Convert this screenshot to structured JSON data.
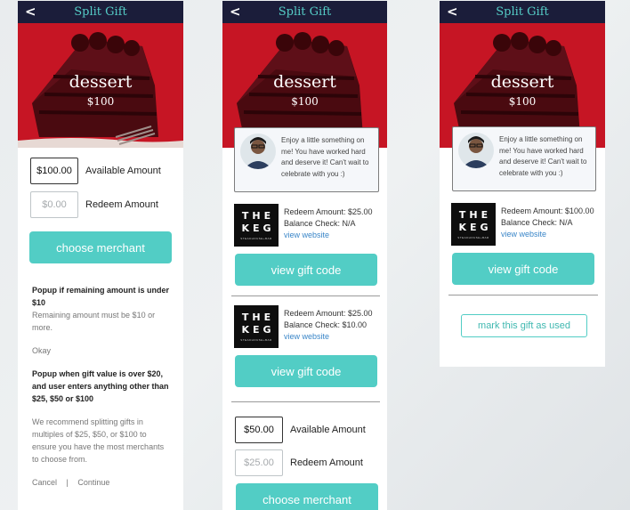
{
  "screens": [
    {
      "back": "<",
      "title": "Split Gift",
      "hero": {
        "name": "dessert",
        "value": "$100"
      },
      "available_amount": "$100.00",
      "available_label": "Available Amount",
      "redeem_amount": "$0.00",
      "redeem_label": "Redeem Amount",
      "choose_button": "choose merchant",
      "notes": {
        "popup1_title": "Popup if remaining amount is under $10",
        "popup1_body": "Remaining amount must be $10 or more.",
        "okay": "Okay",
        "popup2_title": "Popup when gift value is over $20, and user enters anything other than $25, $50 or $100",
        "popup2_body": "We recommend splitting gifts in multiples of $25, $50, or $100 to ensure you have the most merchants to choose from.",
        "cancel": "Cancel",
        "separator": "|",
        "continue": "Continue"
      }
    },
    {
      "back": "<",
      "title": "Split Gift",
      "hero": {
        "name": "dessert",
        "value": "$100"
      },
      "message": "Enjoy a little something on me!  You have worked hard and deserve it! Can't wait to celebrate with you :)",
      "merchants": [
        {
          "logo": [
            "THE",
            "KEG",
            "STEAKHOUSE+BAR"
          ],
          "redeem": "Redeem Amount: $25.00",
          "balance": "Balance Check: N/A",
          "link": "view website",
          "button": "view gift code"
        },
        {
          "logo": [
            "THE",
            "KEG",
            "STEAKHOUSE+BAR"
          ],
          "redeem": "Redeem Amount: $25.00",
          "balance": "Balance Check: $10.00",
          "link": "view website",
          "button": "view gift code"
        }
      ],
      "available_amount": "$50.00",
      "available_label": "Available Amount",
      "redeem_amount": "$25.00",
      "redeem_label": "Redeem Amount",
      "choose_button": "choose merchant"
    },
    {
      "back": "<",
      "title": "Split Gift",
      "hero": {
        "name": "dessert",
        "value": "$100"
      },
      "message": "Enjoy a little something on me!  You have worked hard and deserve it! Can't wait to celebrate with you :)",
      "merchant": {
        "logo": [
          "THE",
          "KEG",
          "STEAKHOUSE+BAR"
        ],
        "redeem": "Redeem Amount: $100.00",
        "balance": "Balance Check: N/A",
        "link": "view website",
        "button": "view gift code"
      },
      "mark_used": "mark this gift as used"
    }
  ],
  "colors": {
    "topbar": "#1b1d3a",
    "title": "#55cdc7",
    "hero_red": "#c61524",
    "teal_button": "#52cdc5",
    "link": "#3a86c8"
  },
  "icons": [
    "back-arrow-icon",
    "cake-image",
    "fork-image",
    "avatar-image",
    "keg-logo"
  ]
}
